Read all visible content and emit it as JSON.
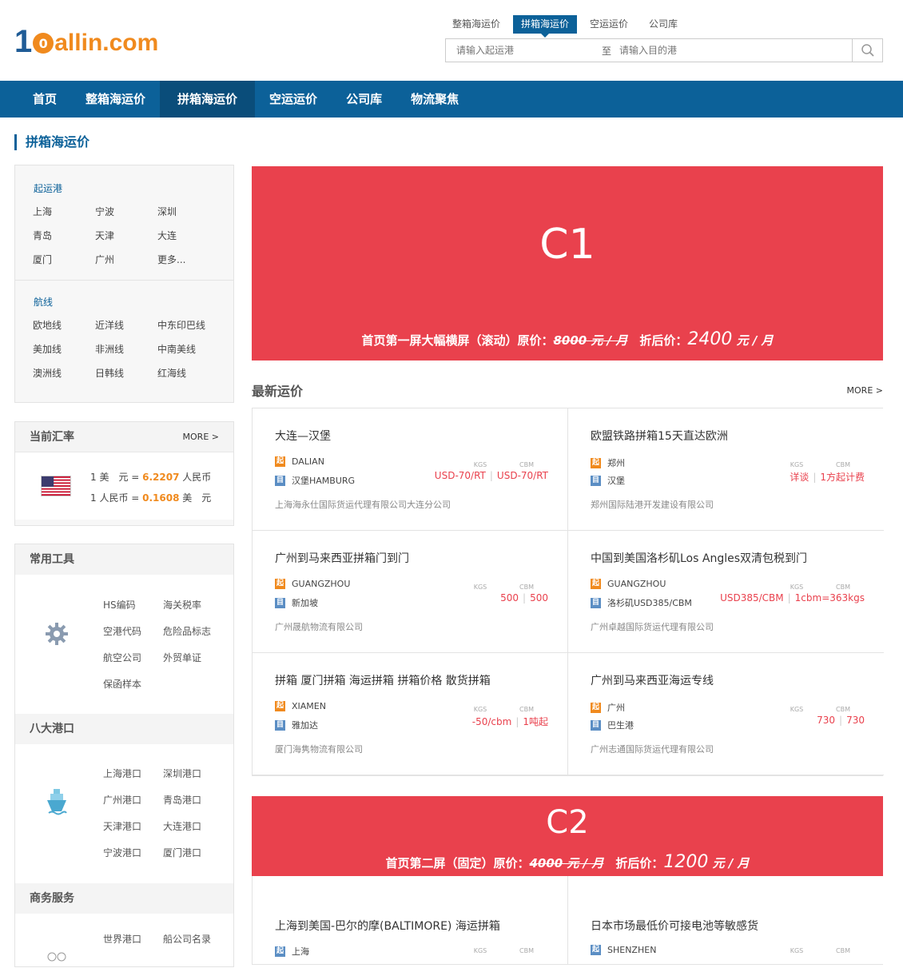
{
  "logo": {
    "d1": "1",
    "ball": "0",
    "d2": "allin.com"
  },
  "search_tabs": [
    "整箱海运价",
    "拼箱海运价",
    "空运运价",
    "公司库"
  ],
  "search": {
    "origin_placeholder": "请输入起运港",
    "to": "至",
    "dest_placeholder": "请输入目的港"
  },
  "nav": [
    "首页",
    "整箱海运价",
    "拼箱海运价",
    "空运运价",
    "公司库",
    "物流聚焦"
  ],
  "page_title": "拼箱海运价",
  "sidebar": {
    "origin_header": "起运港",
    "origins": [
      "上海",
      "宁波",
      "深圳",
      "青岛",
      "天津",
      "大连",
      "厦门",
      "广州",
      "更多..."
    ],
    "route_header": "航线",
    "routes": [
      "欧地线",
      "近洋线",
      "中东印巴线",
      "美加线",
      "非洲线",
      "中南美线",
      "澳洲线",
      "日韩线",
      "红海线"
    ]
  },
  "exchange": {
    "title": "当前汇率",
    "more": "MORE >",
    "l1a": "1 美　元 = ",
    "l1v": "6.2207",
    "l1b": " 人民币",
    "l2a": "1 人民币 = ",
    "l2v": "0.1608",
    "l2b": " 美　元"
  },
  "tools": {
    "title": "常用工具",
    "items": [
      "HS编码",
      "海关税率",
      "空港代码",
      "危险品标志",
      "航空公司",
      "外贸单证",
      "保函样本"
    ]
  },
  "ports": {
    "title": "八大港口",
    "items": [
      "上海港口",
      "深圳港口",
      "广州港口",
      "青岛港口",
      "天津港口",
      "大连港口",
      "宁波港口",
      "厦门港口"
    ]
  },
  "biz": {
    "title": "商务服务",
    "items": [
      "世界港口",
      "船公司名录"
    ]
  },
  "banner1": {
    "label": "C1",
    "cap1": "首页第一屏大幅横屏（滚动）原价：",
    "old": "8000 元 / 月",
    "cap2": "折后价：",
    "price": "2400",
    "unit": " 元 / 月"
  },
  "banner2": {
    "label": "C2",
    "cap1": "首页第二屏（固定）原价：",
    "old": "4000 元 / 月",
    "cap2": "折后价：",
    "price": "1200",
    "unit": " 元 / 月"
  },
  "latest": {
    "title": "最新运价",
    "more": "MORE >"
  },
  "tags": {
    "from": "起",
    "to": "目"
  },
  "kgs": "KGS",
  "cbm": "CBM",
  "cards": [
    {
      "title": "大连—汉堡",
      "from": "DALIAN",
      "to": "汉堡HAMBURG",
      "v1": "USD-70/RT",
      "v2": "USD-70/RT",
      "company": "上海海永仕国际货运代理有限公司大连分公司"
    },
    {
      "title": "欧盟铁路拼箱15天直达欧洲",
      "from": "郑州",
      "to": "汉堡",
      "v1": "详谈",
      "v2": "1方起计费",
      "company": "郑州国际陆港开发建设有限公司"
    },
    {
      "title": "广州到马来西亚拼箱门到门",
      "from": "GUANGZHOU",
      "to": "新加坡",
      "v1": "500",
      "v2": "500",
      "company": "广州晟航物流有限公司"
    },
    {
      "title": "中国到美国洛杉矶Los Angles双清包税到门",
      "from": "GUANGZHOU",
      "to": "洛杉矶USD385/CBM",
      "v1": "USD385/CBM",
      "v2": "1cbm=363kgs",
      "company": "广州卓越国际货运代理有限公司"
    },
    {
      "title": "拼箱 厦门拼箱 海运拼箱 拼箱价格 散货拼箱",
      "from": "XIAMEN",
      "to": "雅加达",
      "v1": "-50/cbm",
      "v2": "1吨起",
      "company": "厦门海隽物流有限公司"
    },
    {
      "title": "广州到马来西亚海运专线",
      "from": "广州",
      "to": "巴生港",
      "v1": "730",
      "v2": "730",
      "company": "广州志通国际货运代理有限公司"
    }
  ],
  "cards2": [
    {
      "title": "上海到美国-巴尔的摩(BALTIMORE) 海运拼箱",
      "from": "上海"
    },
    {
      "title": "日本市场最低价可接电池等敏感货",
      "from": "SHENZHEN"
    }
  ],
  "colors": {
    "brand": "#0c6199",
    "accent": "#f08a1e",
    "banner": "#e9414d"
  }
}
